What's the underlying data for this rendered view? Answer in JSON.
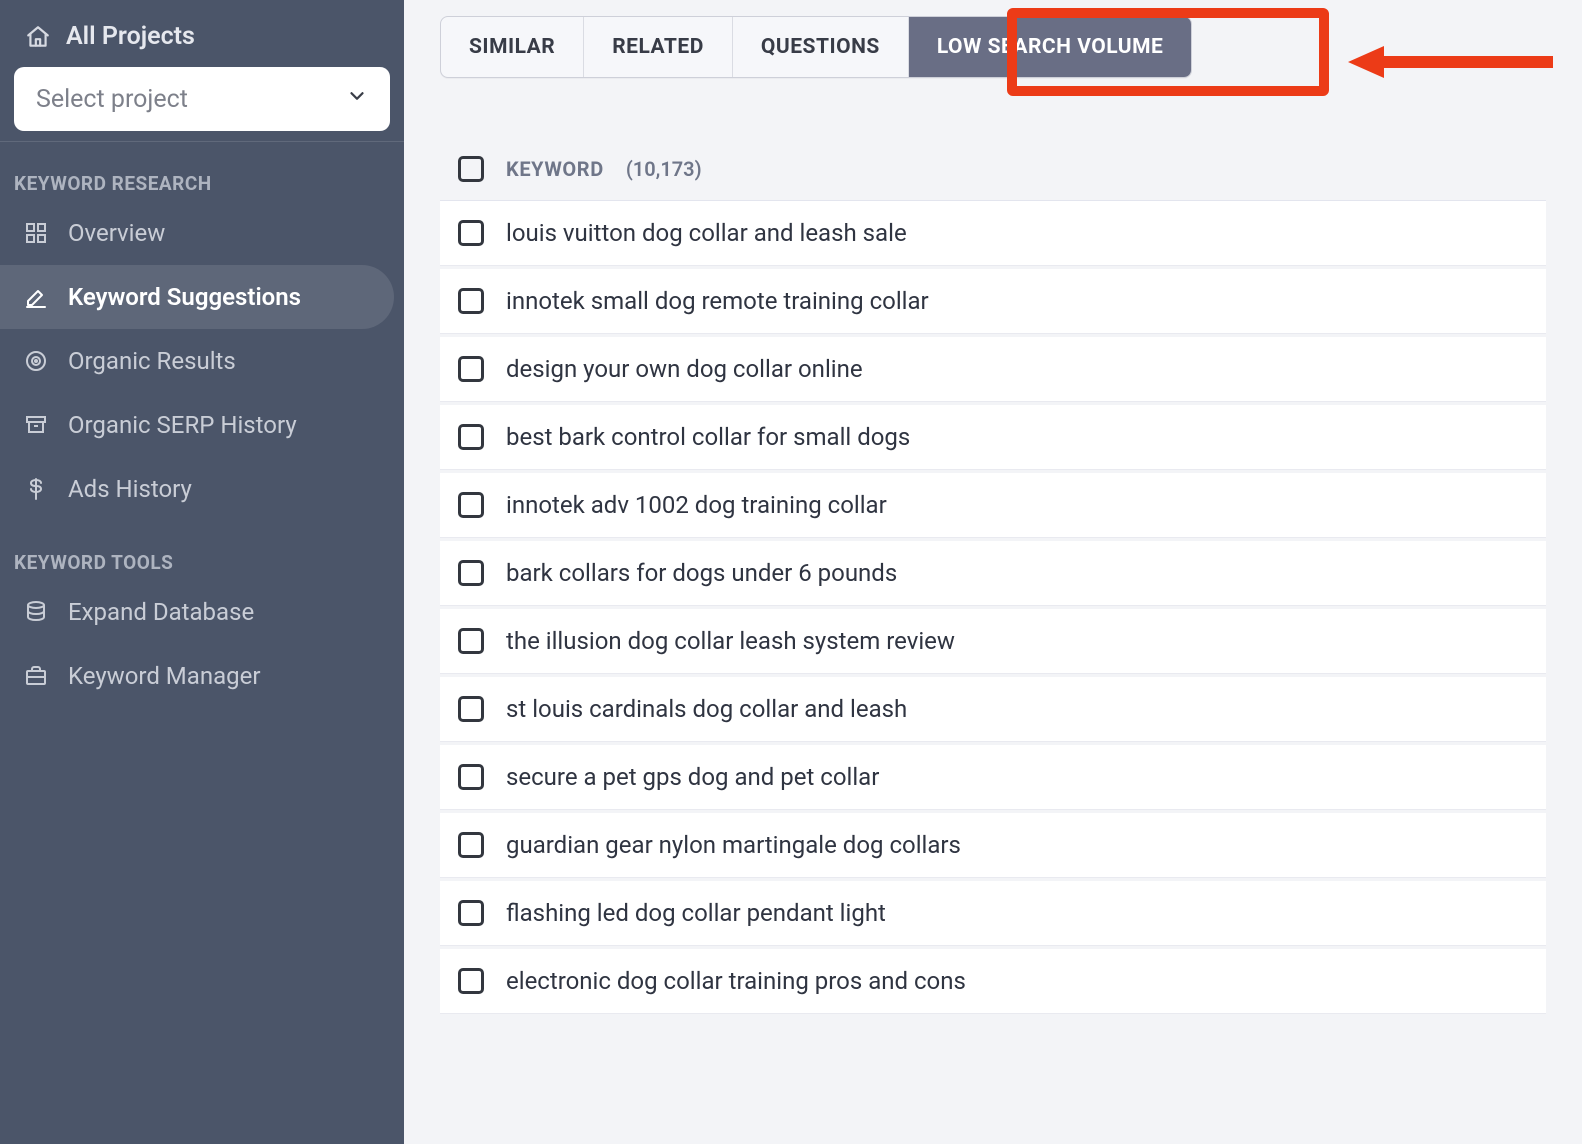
{
  "sidebar": {
    "all_projects_label": "All Projects",
    "select_project_placeholder": "Select project",
    "sections": [
      {
        "label": "KEYWORD RESEARCH",
        "items": [
          {
            "id": "overview",
            "label": "Overview",
            "icon": "grid-icon",
            "active": false
          },
          {
            "id": "suggestions",
            "label": "Keyword Suggestions",
            "icon": "pencil-underline-icon",
            "active": true
          },
          {
            "id": "organic-results",
            "label": "Organic Results",
            "icon": "target-icon",
            "active": false
          },
          {
            "id": "serp-history",
            "label": "Organic SERP History",
            "icon": "archive-icon",
            "active": false
          },
          {
            "id": "ads-history",
            "label": "Ads History",
            "icon": "dollar-icon",
            "active": false
          }
        ]
      },
      {
        "label": "KEYWORD TOOLS",
        "items": [
          {
            "id": "expand-db",
            "label": "Expand Database",
            "icon": "database-icon",
            "active": false
          },
          {
            "id": "kw-manager",
            "label": "Keyword Manager",
            "icon": "briefcase-icon",
            "active": false
          }
        ]
      }
    ]
  },
  "tabs": [
    {
      "id": "similar",
      "label": "SIMILAR",
      "active": false
    },
    {
      "id": "related",
      "label": "RELATED",
      "active": false
    },
    {
      "id": "questions",
      "label": "QUESTIONS",
      "active": false
    },
    {
      "id": "low-search-volume",
      "label": "LOW SEARCH VOLUME",
      "active": true
    }
  ],
  "annotation": {
    "highlight_tab_id": "low-search-volume",
    "arrow_color": "#ec3b17"
  },
  "table": {
    "header_label": "KEYWORD",
    "count_display": "(10,173)",
    "rows": [
      "louis vuitton dog collar and leash sale",
      "innotek small dog remote training collar",
      "design your own dog collar online",
      "best bark control collar for small dogs",
      "innotek adv 1002 dog training collar",
      "bark collars for dogs under 6 pounds",
      "the illusion dog collar leash system review",
      "st louis cardinals dog collar and leash",
      "secure a pet gps dog and pet collar",
      "guardian gear nylon martingale dog collars",
      "flashing led dog collar pendant light",
      "electronic dog collar training pros and cons"
    ]
  }
}
